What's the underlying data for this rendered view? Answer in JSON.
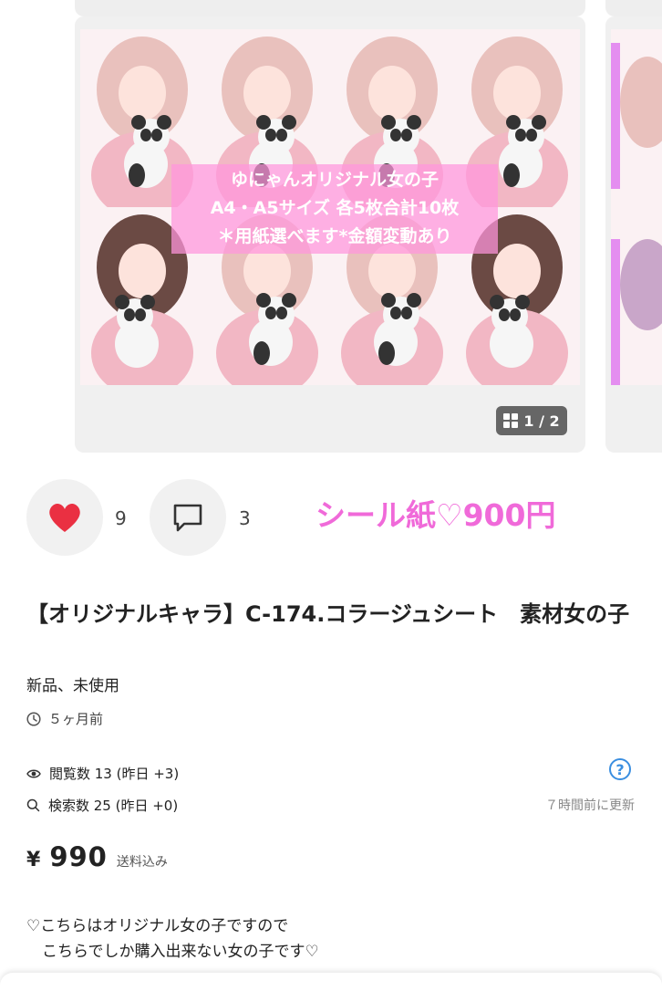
{
  "gallery": {
    "overlay_lines": [
      "ゆにゃんオリジナル女の子",
      "A4・A5サイズ 各5枚合計10枚",
      "＊用紙選べます*金額変動あり"
    ],
    "counter": "1 / 2",
    "caption": "シール紙♡900円",
    "colors": {
      "pink_text": "#f06ad9",
      "overlay": "#ff96dc"
    }
  },
  "actions": {
    "like_count": "9",
    "comment_count": "3"
  },
  "item": {
    "title": "【オリジナルキャラ】C-174.コラージュシート　素材女の子",
    "condition": "新品、未使用",
    "posted": "５ヶ月前"
  },
  "stats": {
    "views": "閲覧数 13 (昨日 +3)",
    "searches": "検索数 25 (昨日 +0)",
    "updated": "７時間前に更新",
    "help_icon": "?"
  },
  "price": {
    "currency": "¥",
    "amount": "990",
    "shipping": "送料込み"
  },
  "description": [
    "♡こちらはオリジナル女の子ですので",
    "　こちらでしか購入出来ない女の子です♡"
  ]
}
